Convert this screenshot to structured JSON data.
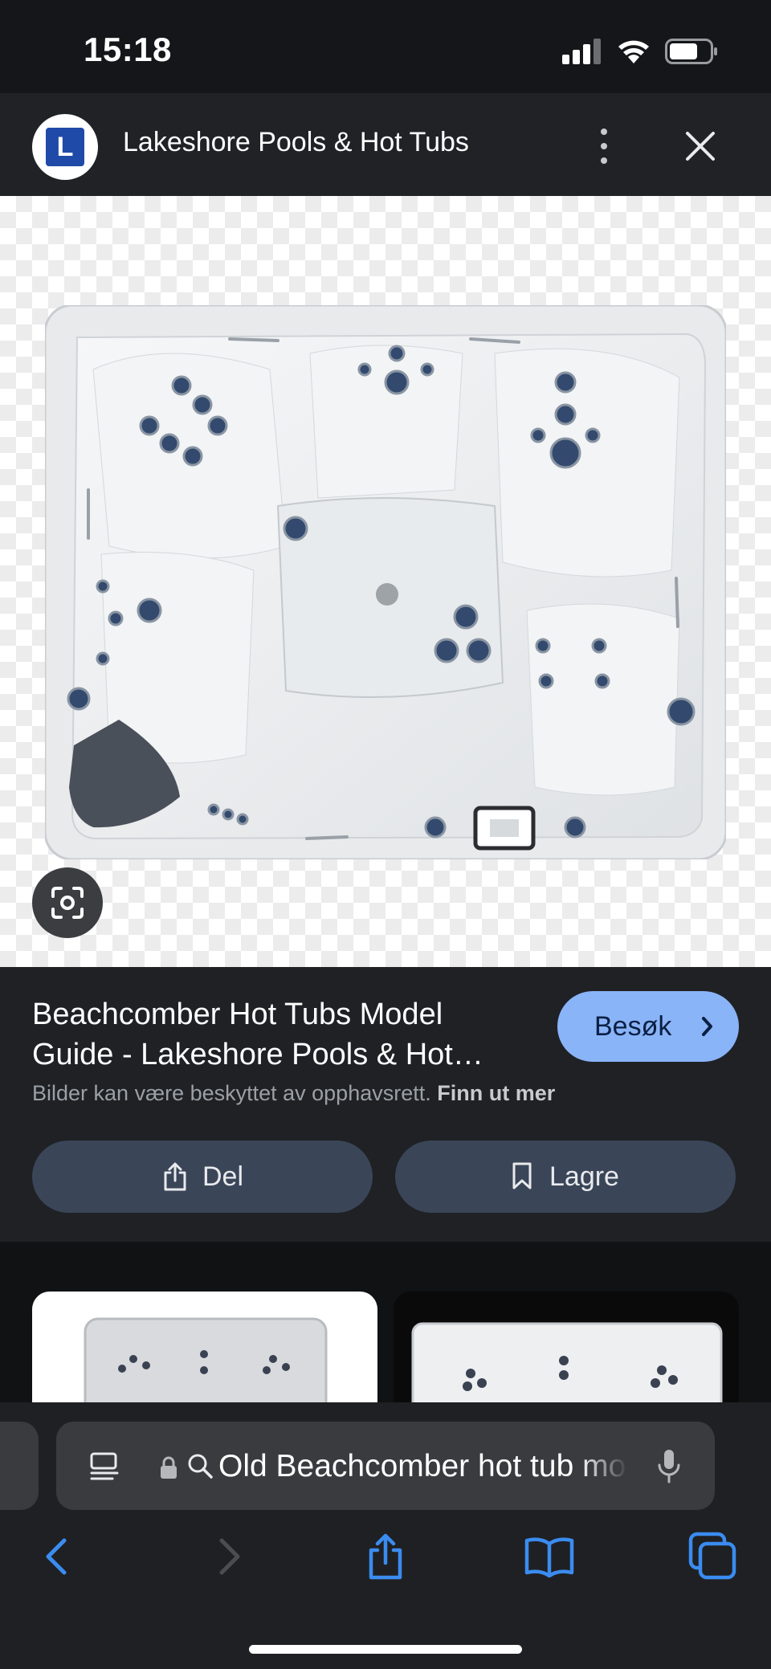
{
  "status_bar": {
    "time": "15:18",
    "icons": [
      "cellular-signal-icon",
      "wifi-icon",
      "battery-icon"
    ]
  },
  "source": {
    "logo_letter": "L",
    "site_name": "Lakeshore Pools & Hot Tubs",
    "icons": [
      "more-vertical-icon",
      "close-icon"
    ]
  },
  "image": {
    "subject": "hot-tub-top-view",
    "lens_icon": "google-lens-icon"
  },
  "result": {
    "title_line1": "Beachcomber Hot Tubs Model",
    "title_line2": "Guide - Lakeshore Pools & Hot…",
    "visit_label": "Besøk",
    "copyright_text": "Bilder kan være beskyttet av opphavsrett.",
    "learn_more": "Finn ut mer",
    "share_label": "Del",
    "save_label": "Lagre"
  },
  "browser": {
    "url_text": "Old Beachcomber hot tub model",
    "icons": [
      "reader-icon",
      "lock-icon",
      "search-icon",
      "microphone-icon",
      "back-icon",
      "forward-icon",
      "share-icon",
      "bookmarks-icon",
      "tabs-icon"
    ]
  },
  "colors": {
    "accent": "#8ab4f8",
    "action_button": "#3a4558",
    "panel": "#1f2125",
    "ios_blue": "#3a8cf0"
  }
}
